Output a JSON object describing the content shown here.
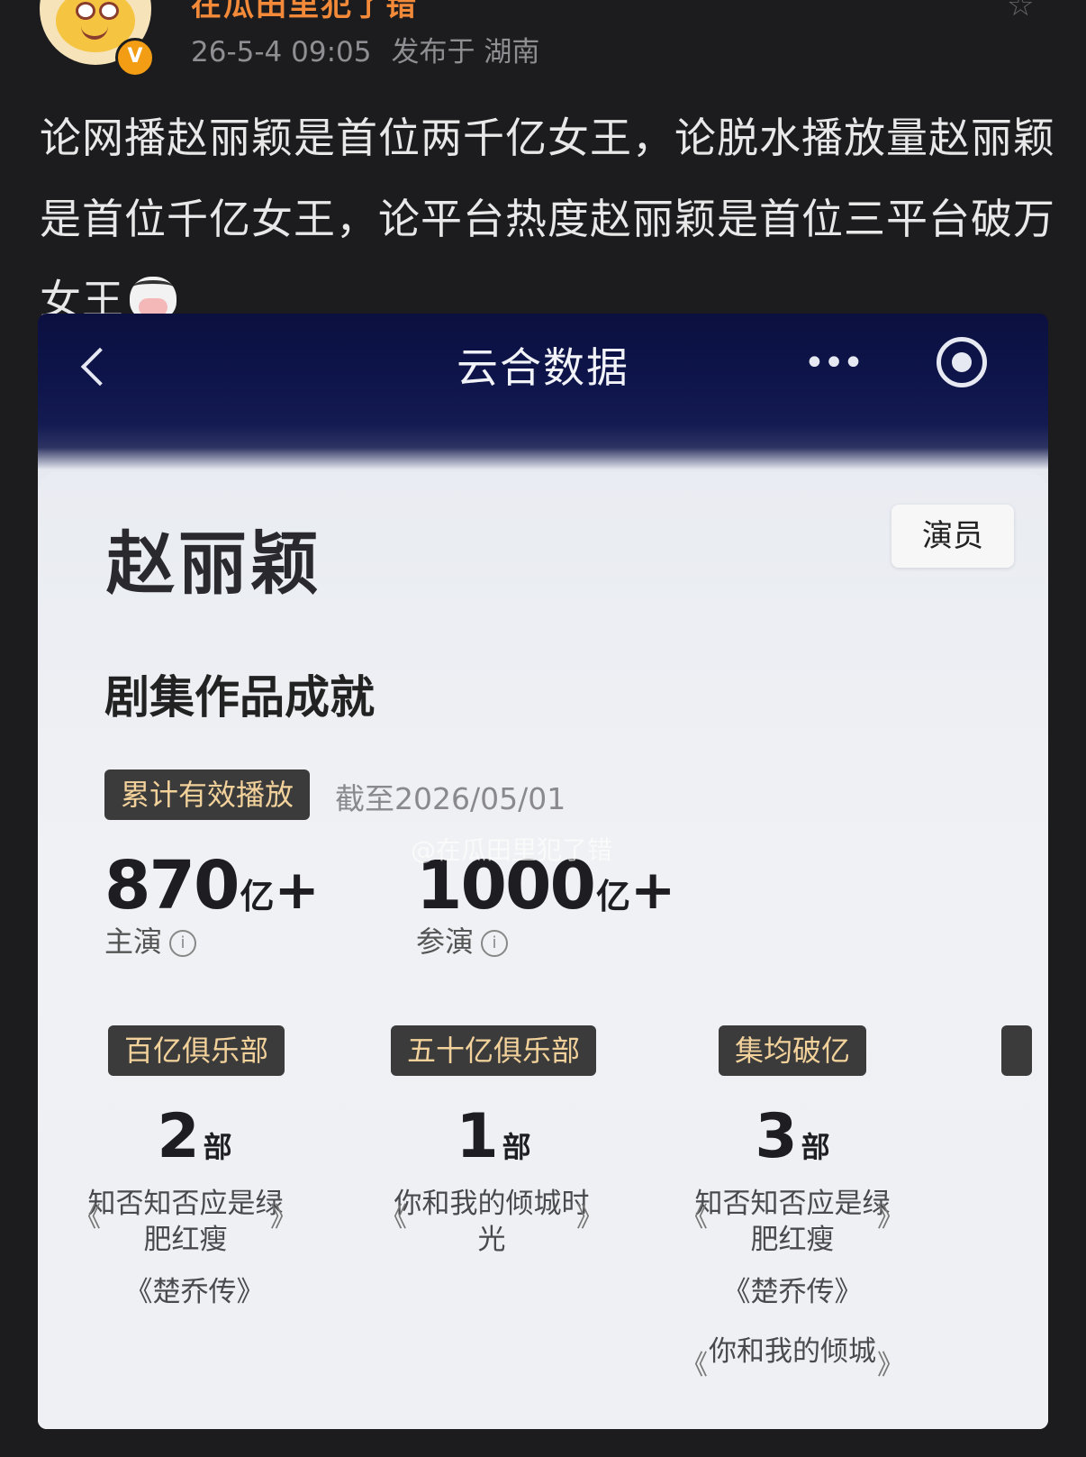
{
  "post": {
    "username": "在瓜田里犯了错",
    "time": "26-5-4 09:05",
    "location": "发布于 湖南",
    "verified_mark": "V",
    "text": "论网播赵丽颖是首位两千亿女王，论脱水播放量赵丽颖是首位千亿女王，论平台热度赵丽颖是首位三平台破万女王",
    "emoji": "cow-face-icon"
  },
  "app": {
    "title": "云合数据",
    "more": "•••"
  },
  "card": {
    "actor_name": "赵丽颖",
    "role_tag": "演员",
    "section_title": "剧集作品成就",
    "play_pill": "累计有效播放",
    "as_of": "截至2026/05/01",
    "watermark": "@在瓜田里犯了错",
    "stats": [
      {
        "num": "870",
        "unit": "亿",
        "plus": "+",
        "label": "主演"
      },
      {
        "num": "1000",
        "unit": "亿",
        "plus": "+",
        "label": "参演"
      }
    ],
    "clubs": [
      {
        "name": "百亿俱乐部",
        "count": "2",
        "unit": "部",
        "works": [
          "知否知否应是绿肥红瘦",
          "《楚乔传》"
        ]
      },
      {
        "name": "五十亿俱乐部",
        "count": "1",
        "unit": "部",
        "works": [
          "你和我的倾城时光"
        ]
      },
      {
        "name": "集均破亿",
        "count": "3",
        "unit": "部",
        "works": [
          "知否知否应是绿肥红瘦",
          "《楚乔传》",
          "你和我的倾城"
        ]
      }
    ],
    "info_glyph": "i",
    "bracket_open": "《",
    "bracket_close": "》"
  }
}
